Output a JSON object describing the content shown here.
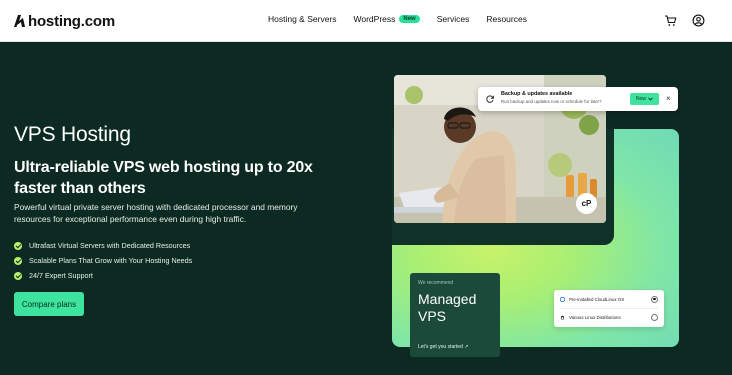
{
  "nav": {
    "logo_text": "hosting.com",
    "links": [
      {
        "label": "Hosting & Servers"
      },
      {
        "label": "WordPress",
        "badge": "New"
      },
      {
        "label": "Services"
      },
      {
        "label": "Resources"
      }
    ],
    "icons": [
      "cart-icon",
      "account-icon"
    ]
  },
  "hero": {
    "title": "VPS Hosting",
    "subtitle": "Ultra-reliable VPS web hosting up to 20x faster than others",
    "description": "Powerful virtual private server hosting with dedicated processor and memory resources for exceptional performance even during high traffic.",
    "features": [
      "Ultrafast Virtual Servers with Dedicated Resources",
      "Scalable Plans That Grow with Your Hosting Needs",
      "24/7 Expert Support"
    ],
    "cta_label": "Compare plans"
  },
  "notification": {
    "title": "Backup & updates available",
    "text": "Run backup and updates now or schedule for later?",
    "button_label": "Now",
    "close_label": "×"
  },
  "cpanel_badge": "cP",
  "recommend_card": {
    "small_label": "We recommend",
    "title": "Managed VPS",
    "link_label": "Let's get you started ↗"
  },
  "os_card": {
    "options": [
      {
        "label": "Pre-installed CloudLinux OS",
        "selected": true
      },
      {
        "label": "Various Linux Distributions",
        "selected": false
      }
    ]
  },
  "colors": {
    "hero_background": "#0d2a22",
    "accent_green": "#3ee49d",
    "lime": "#c8f26a",
    "check": "#b8f36b"
  }
}
